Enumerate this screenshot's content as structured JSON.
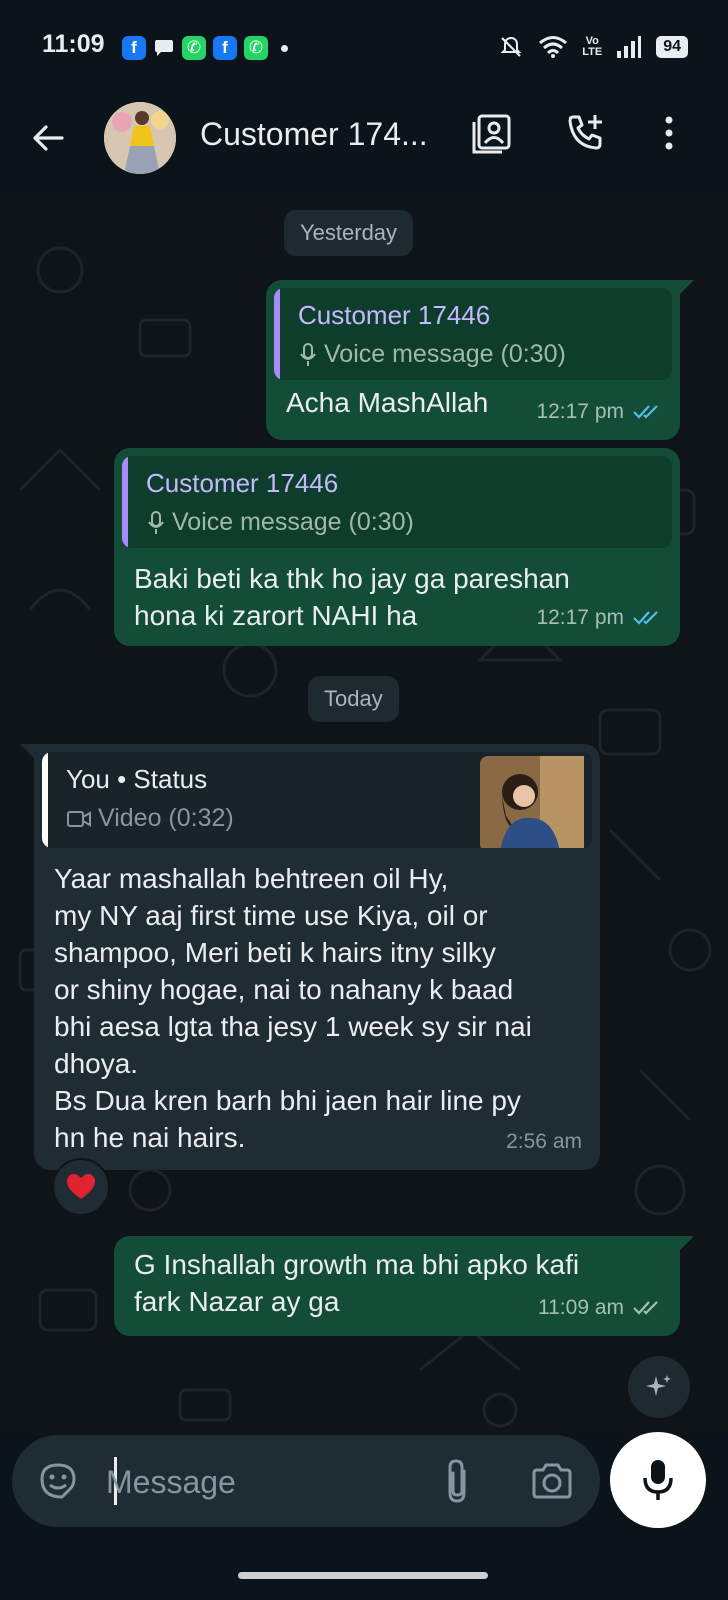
{
  "status_bar": {
    "time": "11:09",
    "battery": "94",
    "volte": "Vo\nLTE"
  },
  "header": {
    "contact_name": "Customer 174..."
  },
  "chat": {
    "date_yesterday": "Yesterday",
    "date_today": "Today",
    "messages": [
      {
        "direction": "outgoing",
        "quote_name": "Customer 17446",
        "quote_sub": "Voice message (0:30)",
        "text": "Acha MashAllah",
        "time": "12:17 pm"
      },
      {
        "direction": "outgoing",
        "quote_name": "Customer 17446",
        "quote_sub": "Voice message (0:30)",
        "text": "Baki beti ka thk ho jay ga pareshan\nhona ki zarort NAHI ha",
        "time": "12:17 pm"
      },
      {
        "direction": "incoming",
        "quote_name": "You • Status",
        "quote_sub": "Video (0:32)",
        "text": "Yaar mashallah behtreen oil Hy,\nmy NY aaj first time use Kiya, oil or\nshampoo, Meri beti k hairs itny silky\nor shiny hogae, nai to nahany k baad\nbhi aesa lgta tha jesy 1 week sy sir nai\ndhoya.\nBs Dua kren barh bhi jaen hair line py\nhn he nai hairs.",
        "time": "2:56 am",
        "reaction": "heart"
      },
      {
        "direction": "outgoing",
        "text": "G Inshallah growth ma bhi apko kafi\nfark Nazar ay ga",
        "time": "11:09 am"
      }
    ]
  },
  "composer": {
    "placeholder": "Message"
  },
  "colors": {
    "outgoing_bubble": "#144d37",
    "incoming_bubble": "#1f2c33",
    "read_ticks": "#53bdeb",
    "sent_ticks": "#a5bfb4",
    "background": "#0b141a"
  }
}
